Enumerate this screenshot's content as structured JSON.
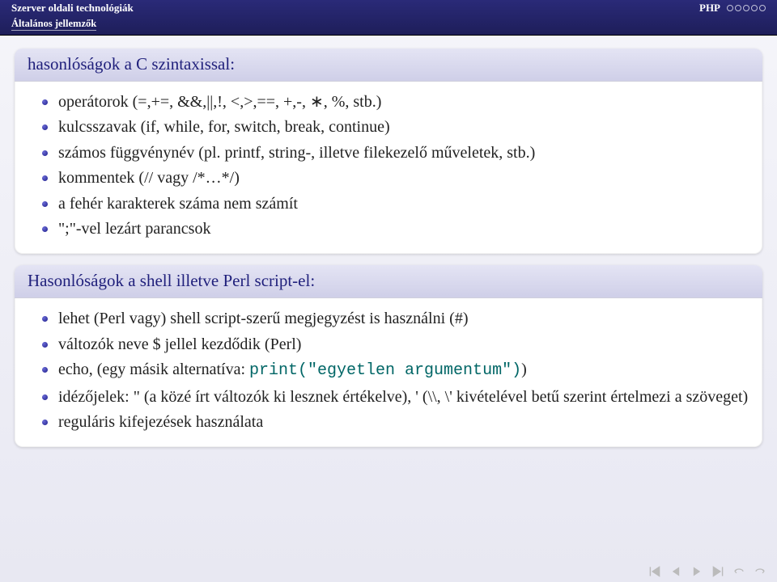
{
  "header": {
    "left": "Szerver oldali technológiák",
    "right": "PHP",
    "sub": "Általános jellemzők"
  },
  "block1": {
    "title": "hasonlóságok a C szintaxissal:",
    "items": [
      "operátorok (=,+=, &&,||,!, <,>,==, +,-, ∗, %, stb.)",
      "kulcsszavak (if, while, for, switch, break, continue)",
      "számos függvénynév (pl. printf, string-, illetve filekezelő műveletek, stb.)",
      "kommentek (// vagy /*…*/)",
      "a fehér karakterek száma nem számít",
      "\";\"-vel lezárt parancsok"
    ]
  },
  "block2": {
    "title": "Hasonlóságok a shell illetve Perl script-el:",
    "item1": "lehet (Perl vagy) shell script-szerű megjegyzést is használni (#)",
    "item2": "változók neve $ jellel kezdődik (Perl)",
    "item3a": "echo, (egy másik alternatíva: ",
    "item3b": "print(\"egyetlen argumentum\")",
    "item3c": ")",
    "item4": "idézőjelek: \" (a közé írt változók ki lesznek értékelve), ' (\\\\, \\' kivételével betű szerint értelmezi a szöveget)",
    "item5": "reguláris kifejezések használata"
  }
}
